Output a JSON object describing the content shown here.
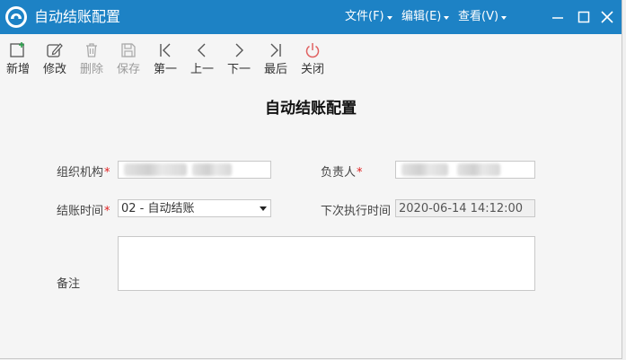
{
  "window": {
    "title": "自动结账配置",
    "accent_color": "#1d82c5",
    "menus": [
      {
        "label": "文件(F)"
      },
      {
        "label": "编辑(E)"
      },
      {
        "label": "查看(V)"
      }
    ]
  },
  "toolbar": {
    "items": [
      {
        "label": "新增",
        "icon": "add-icon",
        "enabled": true
      },
      {
        "label": "修改",
        "icon": "edit-icon",
        "enabled": true
      },
      {
        "label": "删除",
        "icon": "trash-icon",
        "enabled": false
      },
      {
        "label": "保存",
        "icon": "save-icon",
        "enabled": false
      },
      {
        "label": "第一",
        "icon": "first-icon",
        "enabled": true
      },
      {
        "label": "上一",
        "icon": "prev-icon",
        "enabled": true
      },
      {
        "label": "下一",
        "icon": "next-icon",
        "enabled": true
      },
      {
        "label": "最后",
        "icon": "last-icon",
        "enabled": true
      },
      {
        "label": "关闭",
        "icon": "power-icon",
        "enabled": true
      }
    ]
  },
  "form": {
    "heading": "自动结账配置",
    "org_label": "组织机构",
    "owner_label": "负责人",
    "time_label": "结账时间",
    "time_value": "02 - 自动结账",
    "next_time_label": "下次执行时间",
    "next_time_value": "2020-06-14 14:12:00",
    "remark_label": "备注",
    "required_mark": "*"
  }
}
